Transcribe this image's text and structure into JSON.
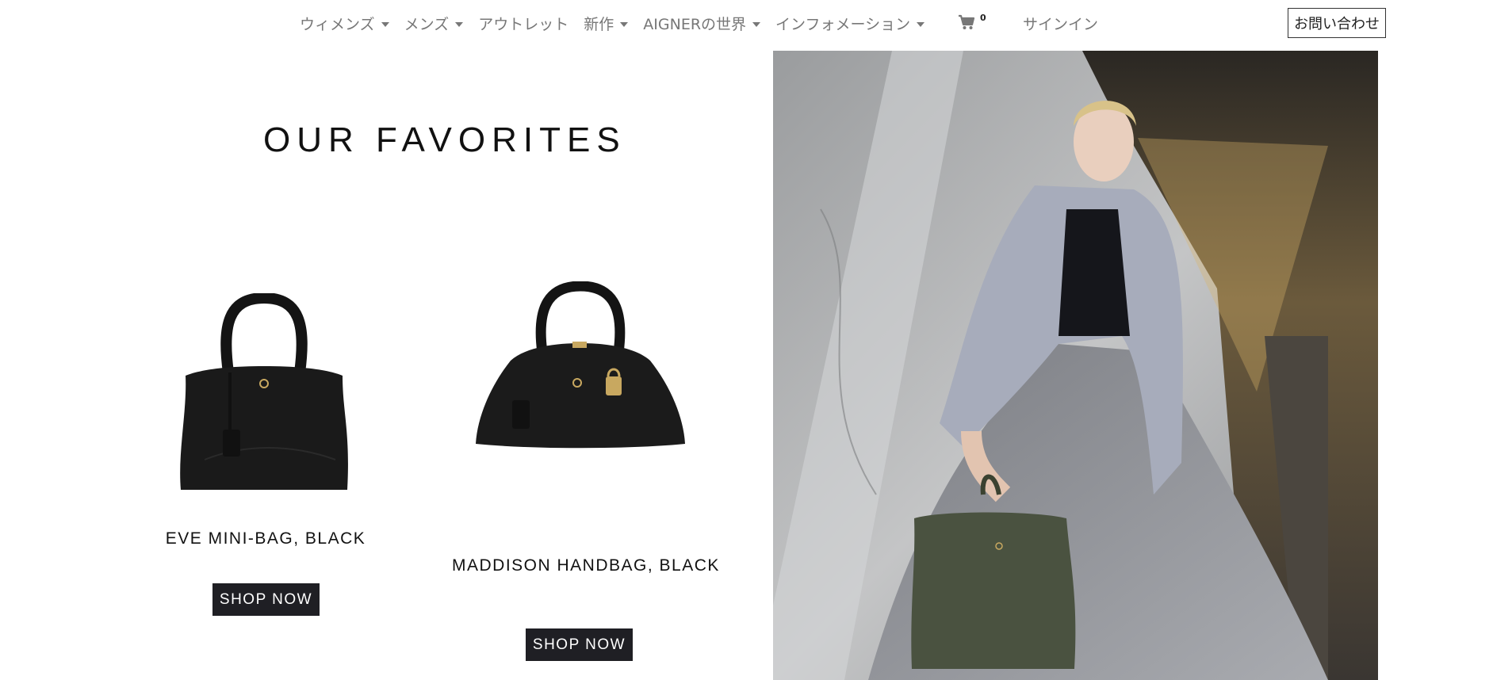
{
  "nav": {
    "items": [
      {
        "label": "ウィメンズ",
        "has_dropdown": true
      },
      {
        "label": "メンズ",
        "has_dropdown": true
      },
      {
        "label": "アウトレット",
        "has_dropdown": false
      },
      {
        "label": "新作",
        "has_dropdown": true
      },
      {
        "label": "AIGNERの世界",
        "has_dropdown": true
      },
      {
        "label": "インフォメーション",
        "has_dropdown": true
      }
    ],
    "cart": {
      "icon": "cart-icon",
      "count": "0"
    },
    "signin_label": "サインイン",
    "contact_label": "お問い合わせ"
  },
  "main": {
    "title": "OUR FAVORITES",
    "products": [
      {
        "name": "EVE MINI-BAG, BLACK",
        "button_label": "SHOP NOW",
        "image": "black-handbag-image"
      },
      {
        "name": "MADDISON HANDBAG, BLACK",
        "button_label": "SHOP NOW",
        "image": "black-barrel-bag-image"
      }
    ],
    "hero_image": "model-with-green-handbag-image"
  },
  "colors": {
    "nav_text": "#777777",
    "button_bg": "#1f1f24",
    "button_text": "#ffffff",
    "heading": "#111111"
  }
}
